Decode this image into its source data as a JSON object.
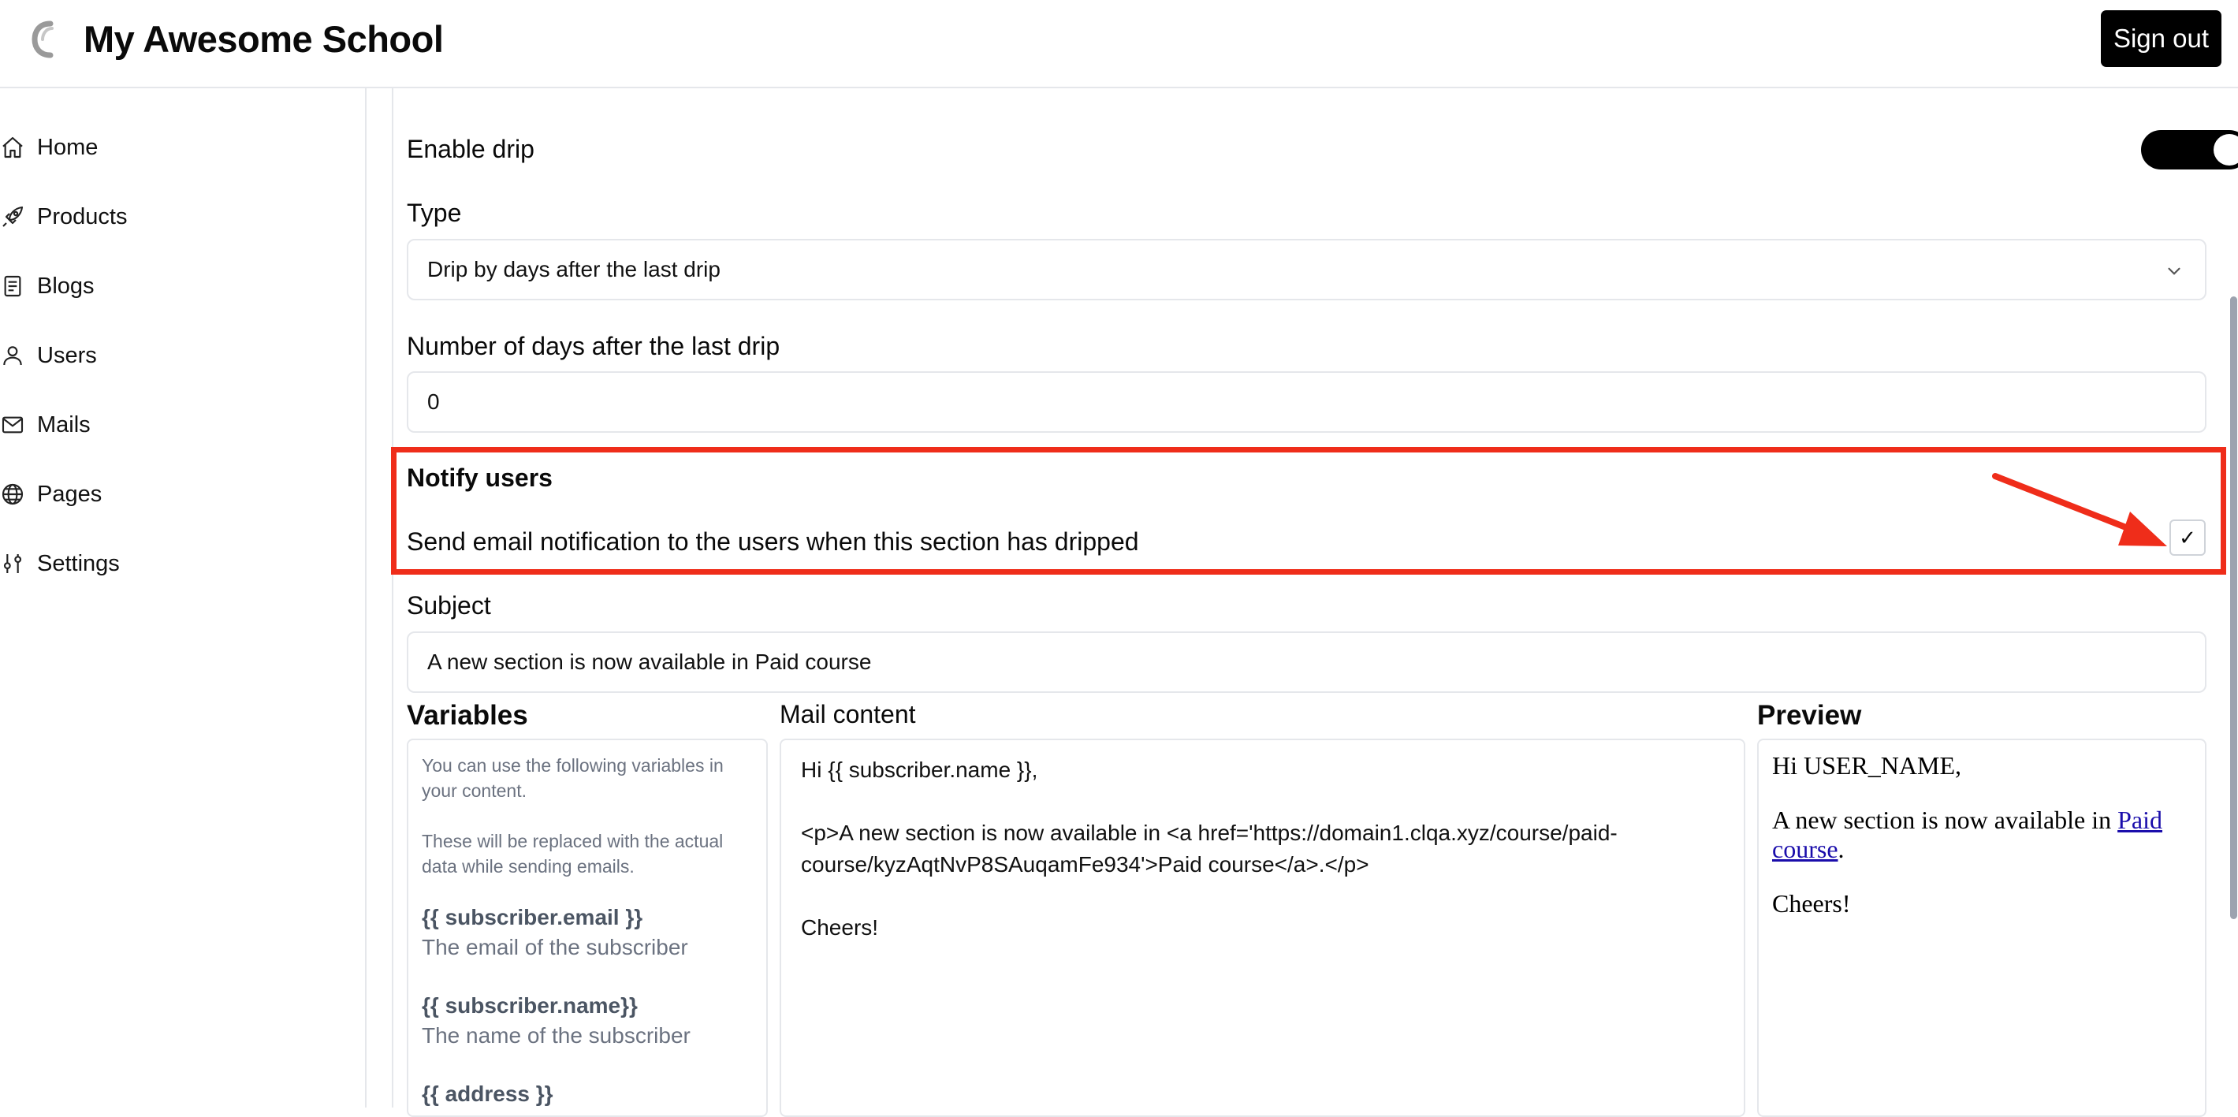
{
  "header": {
    "school_name": "My Awesome School",
    "sign_out": "Sign out"
  },
  "sidebar": {
    "items": [
      {
        "label": "Home",
        "icon": "home-icon"
      },
      {
        "label": "Products",
        "icon": "rocket-icon"
      },
      {
        "label": "Blogs",
        "icon": "document-icon"
      },
      {
        "label": "Users",
        "icon": "user-icon"
      },
      {
        "label": "Mails",
        "icon": "mail-icon"
      },
      {
        "label": "Pages",
        "icon": "globe-icon"
      },
      {
        "label": "Settings",
        "icon": "sliders-icon"
      }
    ]
  },
  "form": {
    "enable_drip_label": "Enable drip",
    "enable_drip_on": true,
    "type_label": "Type",
    "type_value": "Drip by days after the last drip",
    "days_label": "Number of days after the last drip",
    "days_value": "0",
    "notify_title": "Notify users",
    "notify_desc": "Send email notification to the users when this section has dripped",
    "notify_checked": true,
    "checkmark": "✓",
    "subject_label": "Subject",
    "subject_value": "A new section is now available in Paid course"
  },
  "variables": {
    "title": "Variables",
    "intro1": "You can use the following variables in your content.",
    "intro2": "These will be replaced with the actual data while sending emails.",
    "items": [
      {
        "name": "{{ subscriber.email }}",
        "desc": "The email of the subscriber"
      },
      {
        "name": "{{ subscriber.name}}",
        "desc": "The name of the subscriber"
      },
      {
        "name": "{{ address }}",
        "desc": ""
      }
    ]
  },
  "mail": {
    "title": "Mail content",
    "line1": "Hi {{ subscriber.name }},",
    "line2": "<p>A new section is now available in <a href='https://domain1.clqa.xyz/course/paid-",
    "line3": "course/kyzAqtNvP8SAuqamFe934'>Paid course</a>.</p>",
    "line4": "Cheers!"
  },
  "preview": {
    "title": "Preview",
    "greeting": "Hi USER_NAME,",
    "body_prefix": "A new section is now available in",
    "link_text": "Paid course",
    "body_suffix": ".",
    "signoff": "Cheers!"
  },
  "colors": {
    "highlight": "#ef2d1a",
    "toggle_on": "#000000",
    "link": "#1a0dab"
  }
}
